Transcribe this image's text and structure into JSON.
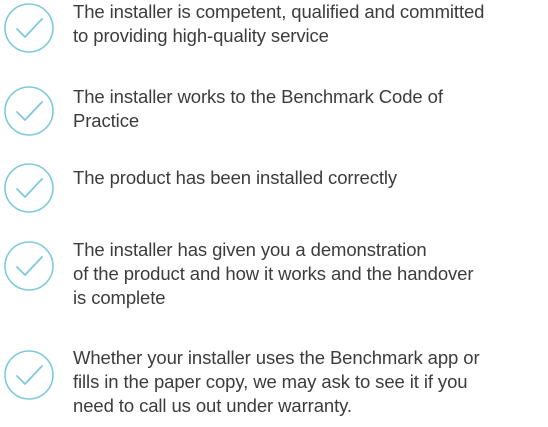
{
  "accent_color": "#7fc9dd",
  "text_color": "#3c3c3c",
  "checklist": {
    "icon": "checkmark-circle-icon",
    "items": [
      {
        "lines": [
          "The installer is competent, qualified and committed",
          "to providing high-quality service"
        ]
      },
      {
        "lines": [
          "The installer works to the Benchmark Code of",
          "Practice"
        ]
      },
      {
        "lines": [
          "The product has been installed correctly"
        ]
      },
      {
        "lines": [
          "The installer has given you a demonstration",
          "of the product and how it works and the handover",
          "is complete"
        ]
      },
      {
        "lines": [
          "Whether your installer uses the Benchmark app or",
          "fills in the paper copy, we may ask to see it if you",
          "need to call us out under warranty."
        ]
      }
    ]
  }
}
